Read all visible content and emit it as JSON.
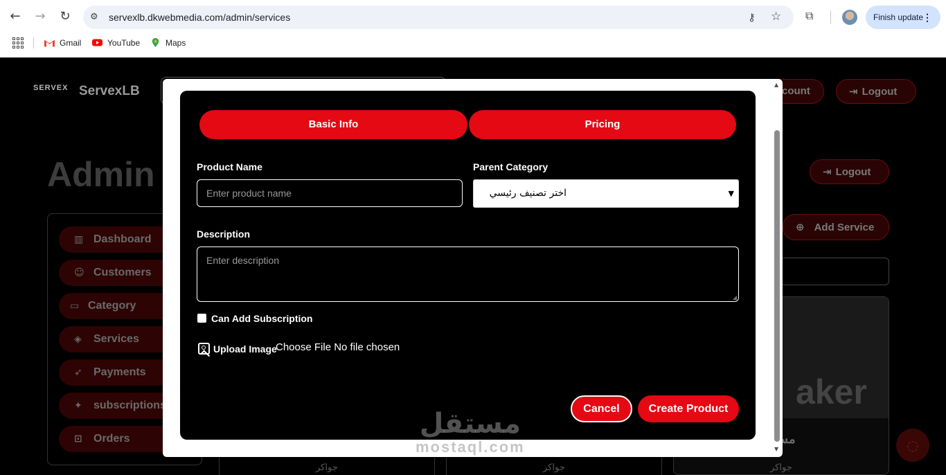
{
  "browser": {
    "url": "servexlb.dkwebmedia.com/admin/services",
    "update_label": "Finish update",
    "bookmarks": [
      {
        "label": "Gmail",
        "icon": "gmail-icon"
      },
      {
        "label": "YouTube",
        "icon": "youtube-icon"
      },
      {
        "label": "Maps",
        "icon": "maps-icon"
      }
    ]
  },
  "header": {
    "brand_logo": "SERVEX",
    "brand_name": "ServexLB",
    "account_label": "count",
    "logout_label": "Logout"
  },
  "main": {
    "title": "Admin",
    "logout_label": "Logout",
    "add_service_label": "Add Service",
    "card_image_text": "aker",
    "card_title": "مسر",
    "card_footer": "جواكر"
  },
  "sidebar": {
    "items": [
      {
        "label": "Dashboard",
        "icon": "chart-icon"
      },
      {
        "label": "Customers",
        "icon": "users-icon"
      },
      {
        "label": "Category",
        "icon": "category-icon"
      },
      {
        "label": "Services",
        "icon": "box-icon"
      },
      {
        "label": "Payments",
        "icon": "rocket-icon"
      },
      {
        "label": "subscriptions",
        "icon": "sparkle-icon"
      },
      {
        "label": "Orders",
        "icon": "cart-icon"
      }
    ]
  },
  "modal": {
    "tabs": [
      {
        "label": "Basic Info"
      },
      {
        "label": "Pricing"
      }
    ],
    "product_name_label": "Product Name",
    "product_name_placeholder": "Enter product name",
    "parent_category_label": "Parent Category",
    "parent_category_value": "اختر تصنيف رئيسي",
    "description_label": "Description",
    "description_placeholder": "Enter description",
    "subscription_label": "Can Add Subscription",
    "subscription_checked": false,
    "upload_label": "Upload Image",
    "file_button_label": "Choose File",
    "file_status": "No file chosen",
    "cancel_label": "Cancel",
    "create_label": "Create Product"
  },
  "watermark": {
    "arabic": "مستقل",
    "latin": "mostaql.com"
  },
  "colors": {
    "accent": "#e50914",
    "background": "#000000",
    "modal_border": "#ffffff"
  }
}
